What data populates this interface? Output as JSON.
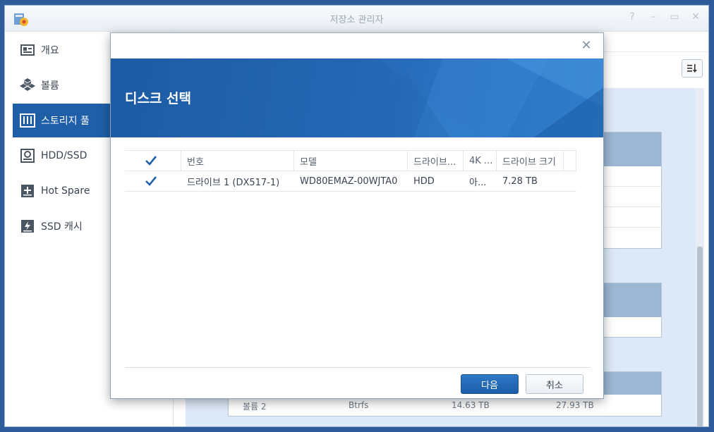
{
  "window": {
    "title": "저장소 관리자"
  },
  "sidebar": {
    "items": [
      {
        "label": "개요",
        "icon": "overview-icon"
      },
      {
        "label": "볼륨",
        "icon": "volume-icon"
      },
      {
        "label": "스토리지 풀",
        "icon": "storage-pool-icon",
        "active": true
      },
      {
        "label": "HDD/SSD",
        "icon": "hdd-icon"
      },
      {
        "label": "Hot Spare",
        "icon": "hot-spare-icon"
      },
      {
        "label": "SSD 캐시",
        "icon": "ssd-cache-icon"
      }
    ]
  },
  "background": {
    "partial_row": {
      "name": "볼륨 2",
      "fs": "Btrfs",
      "used": "14.63 TB",
      "total": "27.93 TB"
    }
  },
  "dialog": {
    "title": "디스크 선택",
    "columns": [
      "번호",
      "모델",
      "드라이브...",
      "4K ...",
      "드라이브 크기"
    ],
    "rows": [
      {
        "checked": true,
        "number": "드라이브 1 (DX517-1)",
        "model": "WD80EMAZ-00WJTA0",
        "type": "HDD",
        "4k": "아...",
        "size": "7.28 TB"
      }
    ],
    "next_label": "다음",
    "cancel_label": "취소"
  },
  "colors": {
    "accent": "#1f5fa8",
    "banner": "#2568b4"
  }
}
